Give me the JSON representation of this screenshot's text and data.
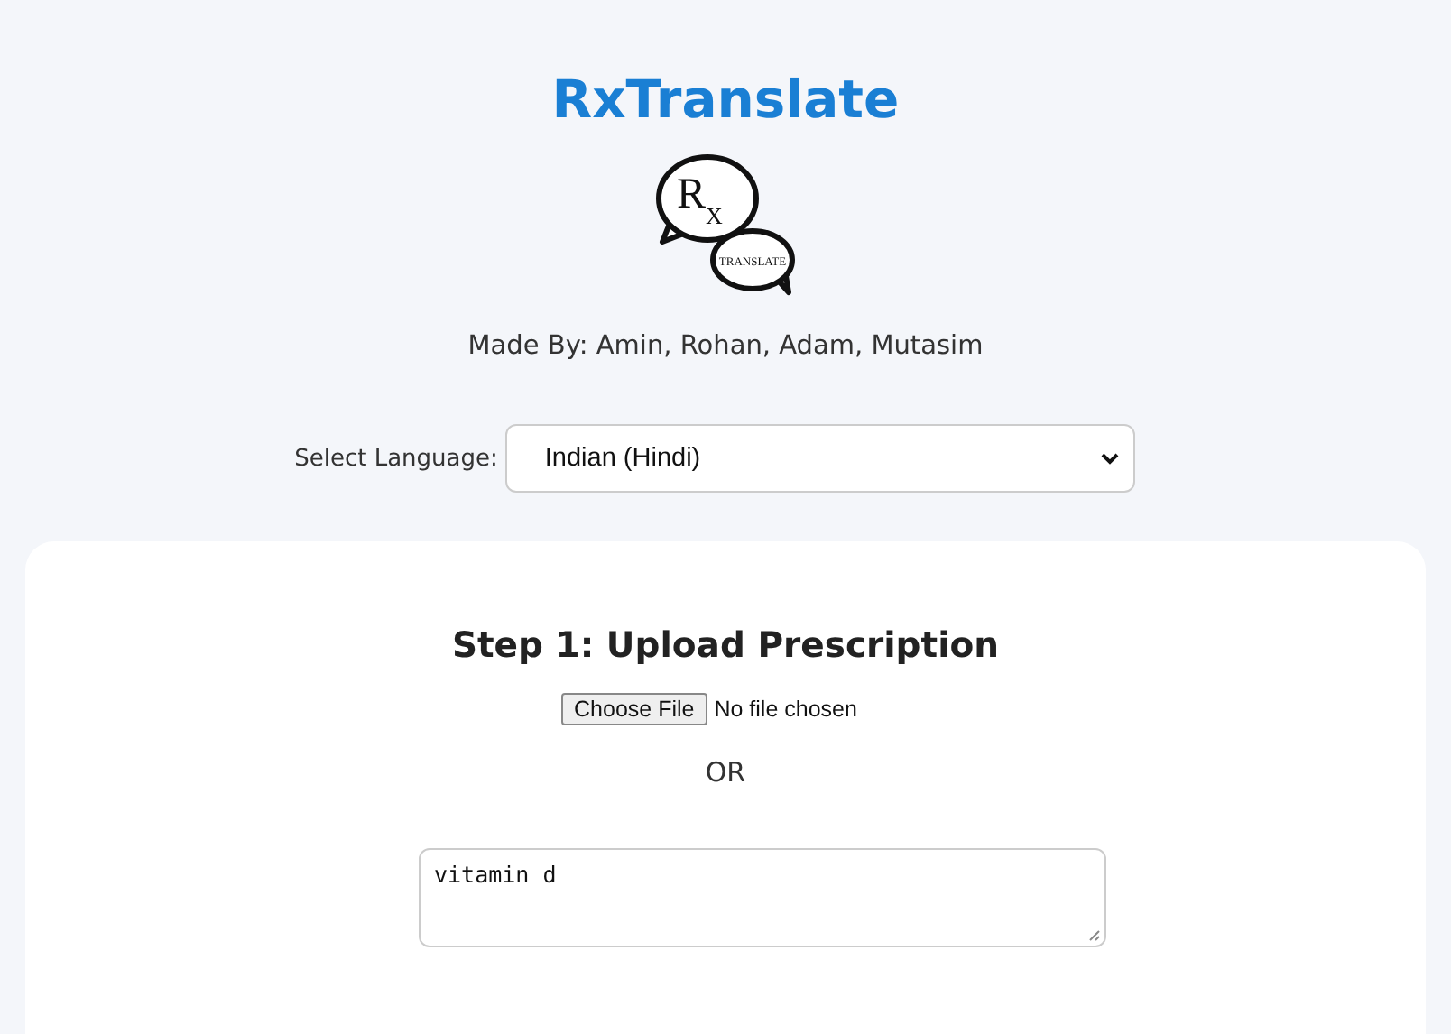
{
  "title": "RxTranslate",
  "logo": {
    "letter": "R",
    "subscript": "X",
    "caption": "TRANSLATE"
  },
  "credits": "Made By: Amin, Rohan, Adam, Mutasim",
  "language": {
    "label": "Select Language:",
    "value": "Indian (Hindi)"
  },
  "step": {
    "heading": "Step 1: Upload Prescription",
    "file_button": "Choose File",
    "file_status": "No file chosen",
    "separator": "OR",
    "text_value": "vitamin d"
  }
}
